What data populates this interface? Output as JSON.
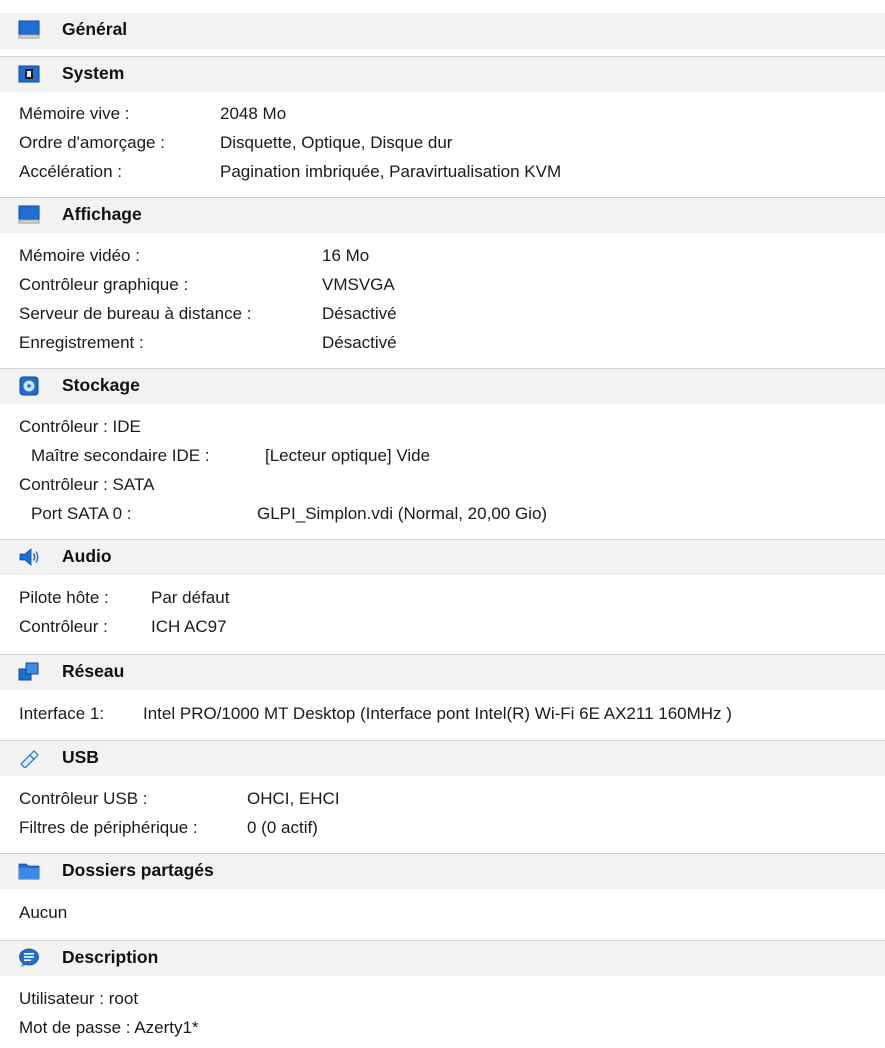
{
  "general": {
    "title": "Général",
    "icon": "monitor-icon"
  },
  "system": {
    "title": "System",
    "icon": "chip-icon",
    "rows": [
      {
        "label": "Mémoire vive :",
        "value": "2048 Mo"
      },
      {
        "label": "Ordre d'amorçage :",
        "value": "Disquette, Optique, Disque dur"
      },
      {
        "label": "Accélération :",
        "value": "Pagination imbriquée, Paravirtualisation KVM"
      }
    ]
  },
  "display": {
    "title": "Affichage",
    "icon": "monitor-icon",
    "rows": [
      {
        "label": "Mémoire vidéo :",
        "value": "16 Mo"
      },
      {
        "label": "Contrôleur graphique :",
        "value": "VMSVGA"
      },
      {
        "label": "Serveur de bureau à distance :",
        "value": "Désactivé"
      },
      {
        "label": "Enregistrement :",
        "value": "Désactivé"
      }
    ]
  },
  "storage": {
    "title": "Stockage",
    "icon": "disk-icon",
    "controller1": "Contrôleur : IDE",
    "row1_label": "Maître secondaire IDE :",
    "row1_value": "[Lecteur optique] Vide",
    "controller2": "Contrôleur : SATA",
    "row2_label": "Port SATA 0 :",
    "row2_value": "GLPI_Simplon.vdi (Normal, 20,00 Gio)"
  },
  "audio": {
    "title": "Audio",
    "icon": "speaker-icon",
    "rows": [
      {
        "label": "Pilote hôte :",
        "value": "Par défaut"
      },
      {
        "label": "Contrôleur :",
        "value": "ICH AC97"
      }
    ]
  },
  "network": {
    "title": "Réseau",
    "icon": "network-icon",
    "row_label": "Interface 1:",
    "row_value": "Intel PRO/1000 MT Desktop (Interface pont Intel(R) Wi-Fi 6E AX211 160MHz )"
  },
  "usb": {
    "title": "USB",
    "icon": "usb-icon",
    "rows": [
      {
        "label": "Contrôleur USB :",
        "value": "OHCI, EHCI"
      },
      {
        "label": "Filtres de périphérique :",
        "value": "0 (0 actif)"
      }
    ]
  },
  "shared": {
    "title": "Dossiers partagés",
    "icon": "folder-icon",
    "value": "Aucun"
  },
  "description": {
    "title": "Description",
    "icon": "speech-bubble-icon",
    "line1": "Utilisateur : root",
    "line2": "Mot de passe : Azerty1*"
  },
  "colors": {
    "header_bg": "#f2f2f2",
    "icon_blue": "#1e6fd0",
    "text": "#1a1a1a"
  }
}
